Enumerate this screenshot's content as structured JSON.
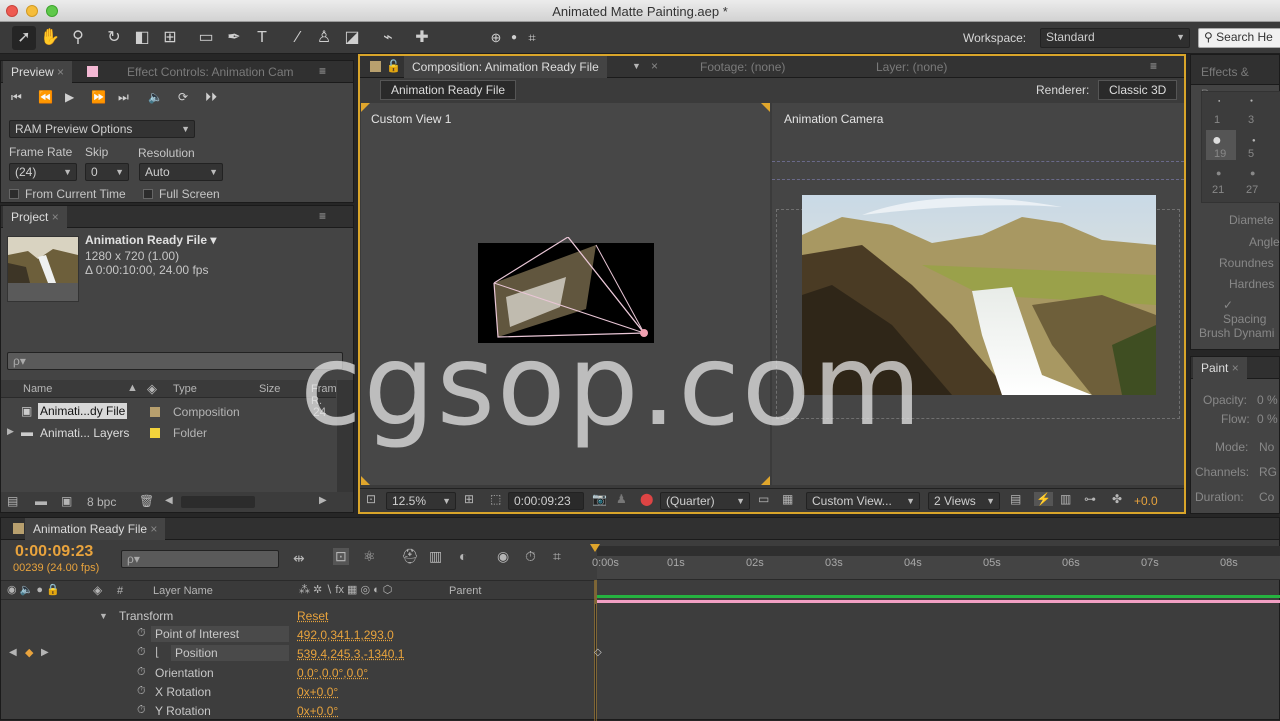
{
  "window": {
    "title": "Animated Matte Painting.aep *"
  },
  "toolbar": {
    "workspace_label": "Workspace:",
    "workspace_value": "Standard",
    "search_placeholder": "Search He"
  },
  "preview": {
    "tab": "Preview",
    "tab2": "Effect Controls: Animation Cam",
    "ram_options": "RAM Preview Options",
    "frame_rate_label": "Frame Rate",
    "skip_label": "Skip",
    "resolution_label": "Resolution",
    "frame_rate": "(24)",
    "skip": "0",
    "resolution": "Auto",
    "from_current": "From Current Time",
    "full_screen": "Full Screen"
  },
  "project": {
    "tab": "Project",
    "comp_name": "Animation Ready File ▾",
    "comp_size": "1280 x 720 (1.00)",
    "comp_dur": "Δ 0:00:10:00, 24.00 fps",
    "search_placeholder": "ρ▾",
    "col_name": "Name",
    "col_type": "Type",
    "col_size": "Size",
    "col_frame": "Frame R.",
    "items": [
      {
        "name": "Animati...dy File",
        "type": "Composition",
        "fr": "24"
      },
      {
        "name": "Animati... Layers",
        "type": "Folder",
        "fr": ""
      }
    ],
    "bpc": "8 bpc"
  },
  "comp": {
    "tab": "Composition: Animation Ready File",
    "tab_footage": "Footage: (none)",
    "tab_layer": "Layer: (none)",
    "crumb": "Animation Ready File",
    "renderer_label": "Renderer:",
    "renderer": "Classic 3D",
    "view_left": "Custom View 1",
    "view_right": "Animation Camera",
    "zoom": "12.5%",
    "timecode": "0:00:09:23",
    "quality": "(Quarter)",
    "view_mode": "Custom View...",
    "views": "2 Views",
    "exposure": "+0.0"
  },
  "effects": {
    "tab": "Effects & Pres",
    "brush_sizes": [
      "1",
      "3",
      "19",
      "5",
      "21",
      "27"
    ],
    "props": [
      "Diamete",
      "Angle",
      "Roundnes",
      "Hardnes",
      "Spacing",
      "Brush Dynami"
    ]
  },
  "paint": {
    "tab": "Paint",
    "opacity_label": "Opacity:",
    "opacity": "0 %",
    "flow_label": "Flow:",
    "flow": "0 %",
    "mode_label": "Mode:",
    "mode": "No",
    "channels_label": "Channels:",
    "channels": "RG",
    "duration_label": "Duration:",
    "duration": "Co"
  },
  "timeline": {
    "tab": "Animation Ready File",
    "timecode": "0:00:09:23",
    "frames": "00239 (24.00 fps)",
    "col_layer": "Layer Name",
    "col_parent": "Parent",
    "col_num": "#",
    "ticks": [
      "0:00s",
      "01s",
      "02s",
      "03s",
      "04s",
      "05s",
      "06s",
      "07s",
      "08s"
    ],
    "transform": "Transform",
    "reset": "Reset",
    "properties": [
      {
        "name": "Point of Interest",
        "value": "492.0,341.1,293.0"
      },
      {
        "name": "Position",
        "value": "539.4,245.3,-1340.1"
      },
      {
        "name": "Orientation",
        "value": "0.0°,0.0°,0.0°"
      },
      {
        "name": "X Rotation",
        "value": "0x+0.0°"
      },
      {
        "name": "Y Rotation",
        "value": "0x+0.0°"
      }
    ]
  },
  "watermark": "cgsop.com"
}
